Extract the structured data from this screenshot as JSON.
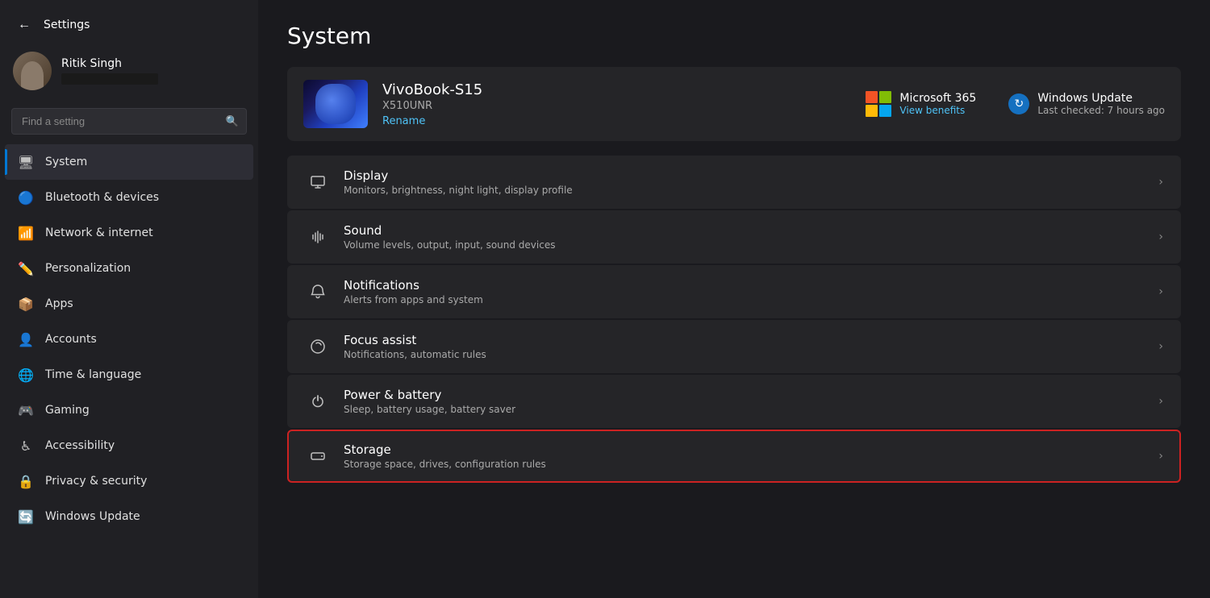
{
  "window": {
    "title": "Settings"
  },
  "sidebar": {
    "back_button": "←",
    "title": "Settings",
    "user": {
      "name": "Ritik Singh"
    },
    "search": {
      "placeholder": "Find a setting"
    },
    "nav_items": [
      {
        "id": "system",
        "label": "System",
        "icon": "🖥",
        "active": true
      },
      {
        "id": "bluetooth",
        "label": "Bluetooth & devices",
        "icon": "🔵",
        "active": false
      },
      {
        "id": "network",
        "label": "Network & internet",
        "icon": "📶",
        "active": false
      },
      {
        "id": "personalization",
        "label": "Personalization",
        "icon": "✏️",
        "active": false
      },
      {
        "id": "apps",
        "label": "Apps",
        "icon": "📦",
        "active": false
      },
      {
        "id": "accounts",
        "label": "Accounts",
        "icon": "👤",
        "active": false
      },
      {
        "id": "time",
        "label": "Time & language",
        "icon": "🌐",
        "active": false
      },
      {
        "id": "gaming",
        "label": "Gaming",
        "icon": "🎮",
        "active": false
      },
      {
        "id": "accessibility",
        "label": "Accessibility",
        "icon": "♿",
        "active": false
      },
      {
        "id": "privacy",
        "label": "Privacy & security",
        "icon": "🔒",
        "active": false
      },
      {
        "id": "windowsupdate",
        "label": "Windows Update",
        "icon": "🔄",
        "active": false
      }
    ]
  },
  "main": {
    "page_title": "System",
    "device": {
      "name": "VivoBook-S15",
      "model": "X510UNR",
      "rename_label": "Rename"
    },
    "actions": [
      {
        "id": "microsoft365",
        "label": "Microsoft 365",
        "sub": "View benefits"
      },
      {
        "id": "windowsupdate",
        "label": "Windows Update",
        "sub": "Last checked: 7 hours ago"
      }
    ],
    "settings_items": [
      {
        "id": "display",
        "icon": "🖥",
        "title": "Display",
        "desc": "Monitors, brightness, night light, display profile",
        "highlighted": false
      },
      {
        "id": "sound",
        "icon": "🔊",
        "title": "Sound",
        "desc": "Volume levels, output, input, sound devices",
        "highlighted": false
      },
      {
        "id": "notifications",
        "icon": "🔔",
        "title": "Notifications",
        "desc": "Alerts from apps and system",
        "highlighted": false
      },
      {
        "id": "focus",
        "icon": "🌙",
        "title": "Focus assist",
        "desc": "Notifications, automatic rules",
        "highlighted": false
      },
      {
        "id": "power",
        "icon": "⏻",
        "title": "Power & battery",
        "desc": "Sleep, battery usage, battery saver",
        "highlighted": false
      },
      {
        "id": "storage",
        "icon": "💾",
        "title": "Storage",
        "desc": "Storage space, drives, configuration rules",
        "highlighted": true
      }
    ]
  }
}
